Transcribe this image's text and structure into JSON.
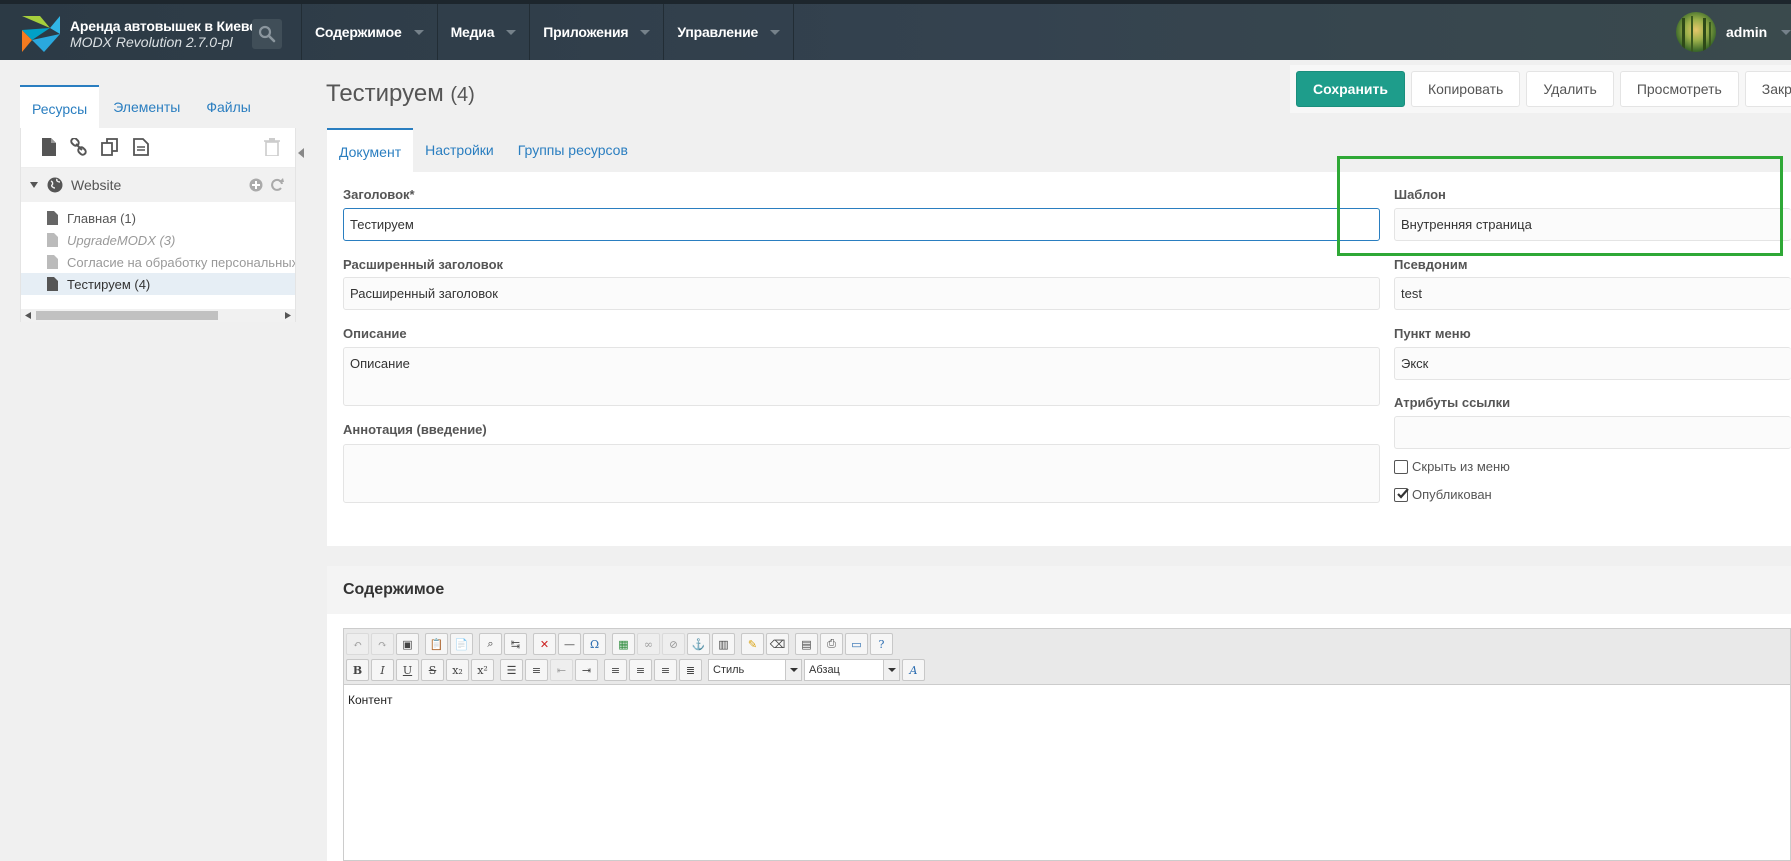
{
  "app": {
    "site_name": "Аренда автовышек в Киеве",
    "version": "MODX Revolution 2.7.0-pl",
    "nav": [
      "Содержимое",
      "Медиа",
      "Приложения",
      "Управление"
    ],
    "user": "admin",
    "colors": {
      "topbar": "#34424f",
      "accent": "#2a7ec0",
      "primary_button": "#1e9d8b",
      "highlight": "#2fa836"
    }
  },
  "sidebar": {
    "tabs": [
      "Ресурсы",
      "Элементы",
      "Файлы"
    ],
    "active_tab": "Ресурсы",
    "toolbar_icons": [
      "new-document-icon",
      "weblink-icon",
      "symlink-icon",
      "static-resource-icon",
      "trash-icon"
    ],
    "root": "Website",
    "items": [
      {
        "label": "Главная (1)",
        "style": "normal"
      },
      {
        "label": "UpgradeMODX (3)",
        "style": "unpublished"
      },
      {
        "label": "Согласие на обработку персональных данных",
        "style": "hidden"
      },
      {
        "label": "Тестируем (4)",
        "style": "selected"
      }
    ]
  },
  "page": {
    "title": "Тестируем",
    "title_id": "(4)",
    "actions": [
      "Сохранить",
      "Копировать",
      "Удалить",
      "Просмотреть",
      "Закрыть"
    ],
    "tabs": [
      "Документ",
      "Настройки",
      "Группы ресурсов"
    ],
    "active_tab": "Документ"
  },
  "form": {
    "title_label": "Заголовок*",
    "title_value": "Тестируем",
    "longtitle_label": "Расширенный заголовок",
    "longtitle_placeholder": "Расширенный заголовок",
    "description_label": "Описание",
    "description_placeholder": "Описание",
    "introtext_label": "Аннотация (введение)",
    "introtext_value": "",
    "template_label": "Шаблон",
    "template_value": "Внутренняя страница",
    "alias_label": "Псевдоним",
    "alias_value": "test",
    "menutitle_label": "Пункт меню",
    "menutitle_value": "Экск",
    "link_attributes_label": "Атрибуты ссылки",
    "link_attributes_value": "",
    "hidemenu_label": "Скрыть из меню",
    "hidemenu_checked": false,
    "published_label": "Опубликован",
    "published_checked": true
  },
  "content": {
    "heading": "Содержимое",
    "style_select": "Стиль",
    "format_select": "Абзац",
    "body": "Контент"
  }
}
